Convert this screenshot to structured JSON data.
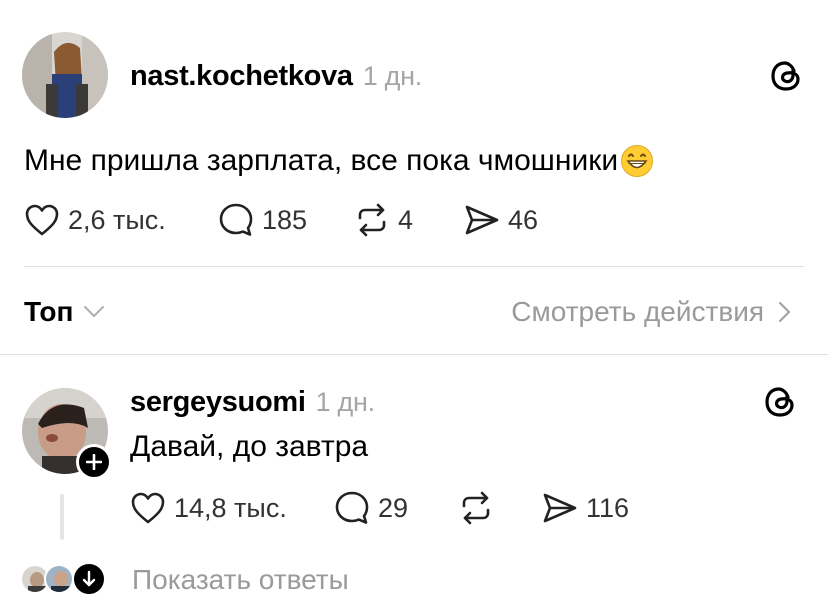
{
  "post": {
    "username": "nast.kochetkova",
    "time": "1 дн.",
    "text": "Мне пришла зарплата, все пока чмошники",
    "emoji": "😁",
    "likes": "2,6 тыс.",
    "replies": "185",
    "reposts": "4",
    "shares": "46"
  },
  "sort": {
    "label": "Топ",
    "view_activity": "Смотреть действия"
  },
  "reply": {
    "username": "sergeysuomi",
    "time": "1 дн.",
    "text": "Давай, до завтра",
    "likes": "14,8 тыс.",
    "replies": "29",
    "reposts": "",
    "shares": "116"
  },
  "show_replies": {
    "label": "Показать ответы"
  },
  "icons": {
    "threads": "threads-logo-icon",
    "like": "heart-icon",
    "reply": "speech-bubble-icon",
    "repost": "repost-icon",
    "share": "paper-plane-icon",
    "follow": "plus-icon",
    "expand": "arrow-down-icon"
  },
  "colors": {
    "text": "#000000",
    "muted": "#9a9a9a",
    "divider": "#e0e0e0"
  }
}
